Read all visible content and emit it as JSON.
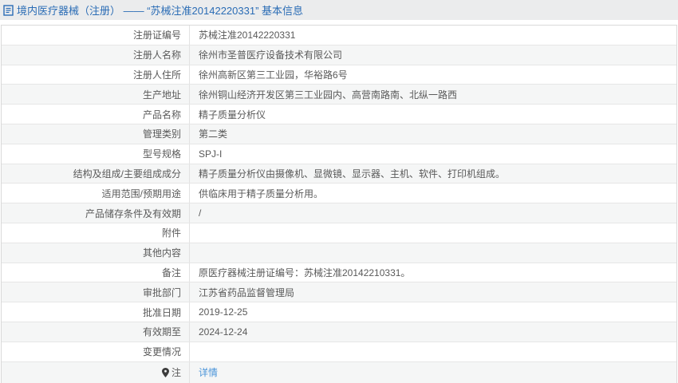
{
  "header": {
    "title": "境内医疗器械（注册） —— “苏械注准20142220331” 基本信息",
    "doc_icon": "document-icon"
  },
  "colors": {
    "header_bg": "#ebeced",
    "title_blue": "#2a6cb5",
    "link_blue": "#4a94d9",
    "zebra_gray": "#f5f6f6",
    "border_gray": "#e2e2e2",
    "text_gray": "#595959"
  },
  "table": {
    "rows": [
      {
        "label": "注册证编号",
        "value": "苏械注准20142220331"
      },
      {
        "label": "注册人名称",
        "value": "徐州市圣普医疗设备技术有限公司"
      },
      {
        "label": "注册人住所",
        "value": "徐州高新区第三工业园，华裕路6号"
      },
      {
        "label": "生产地址",
        "value": "徐州铜山经济开发区第三工业园内、高营南路南、北纵一路西"
      },
      {
        "label": "产品名称",
        "value": "精子质量分析仪"
      },
      {
        "label": "管理类别",
        "value": "第二类"
      },
      {
        "label": "型号规格",
        "value": "SPJ-I"
      },
      {
        "label": "结构及组成/主要组成成分",
        "value": "精子质量分析仪由摄像机、显微镜、显示器、主机、软件、打印机组成。"
      },
      {
        "label": "适用范围/预期用途",
        "value": "供临床用于精子质量分析用。"
      },
      {
        "label": "产品储存条件及有效期",
        "value": "/"
      },
      {
        "label": "附件",
        "value": ""
      },
      {
        "label": "其他内容",
        "value": ""
      },
      {
        "label": "备注",
        "value": "原医疗器械注册证编号：苏械注准20142210331。"
      },
      {
        "label": "审批部门",
        "value": "江苏省药品监督管理局"
      },
      {
        "label": "批准日期",
        "value": "2019-12-25"
      },
      {
        "label": "有效期至",
        "value": "2024-12-24"
      },
      {
        "label": "变更情况",
        "value": ""
      },
      {
        "label": "注",
        "value": "详情",
        "link": true,
        "icon": "pin-icon"
      }
    ]
  }
}
